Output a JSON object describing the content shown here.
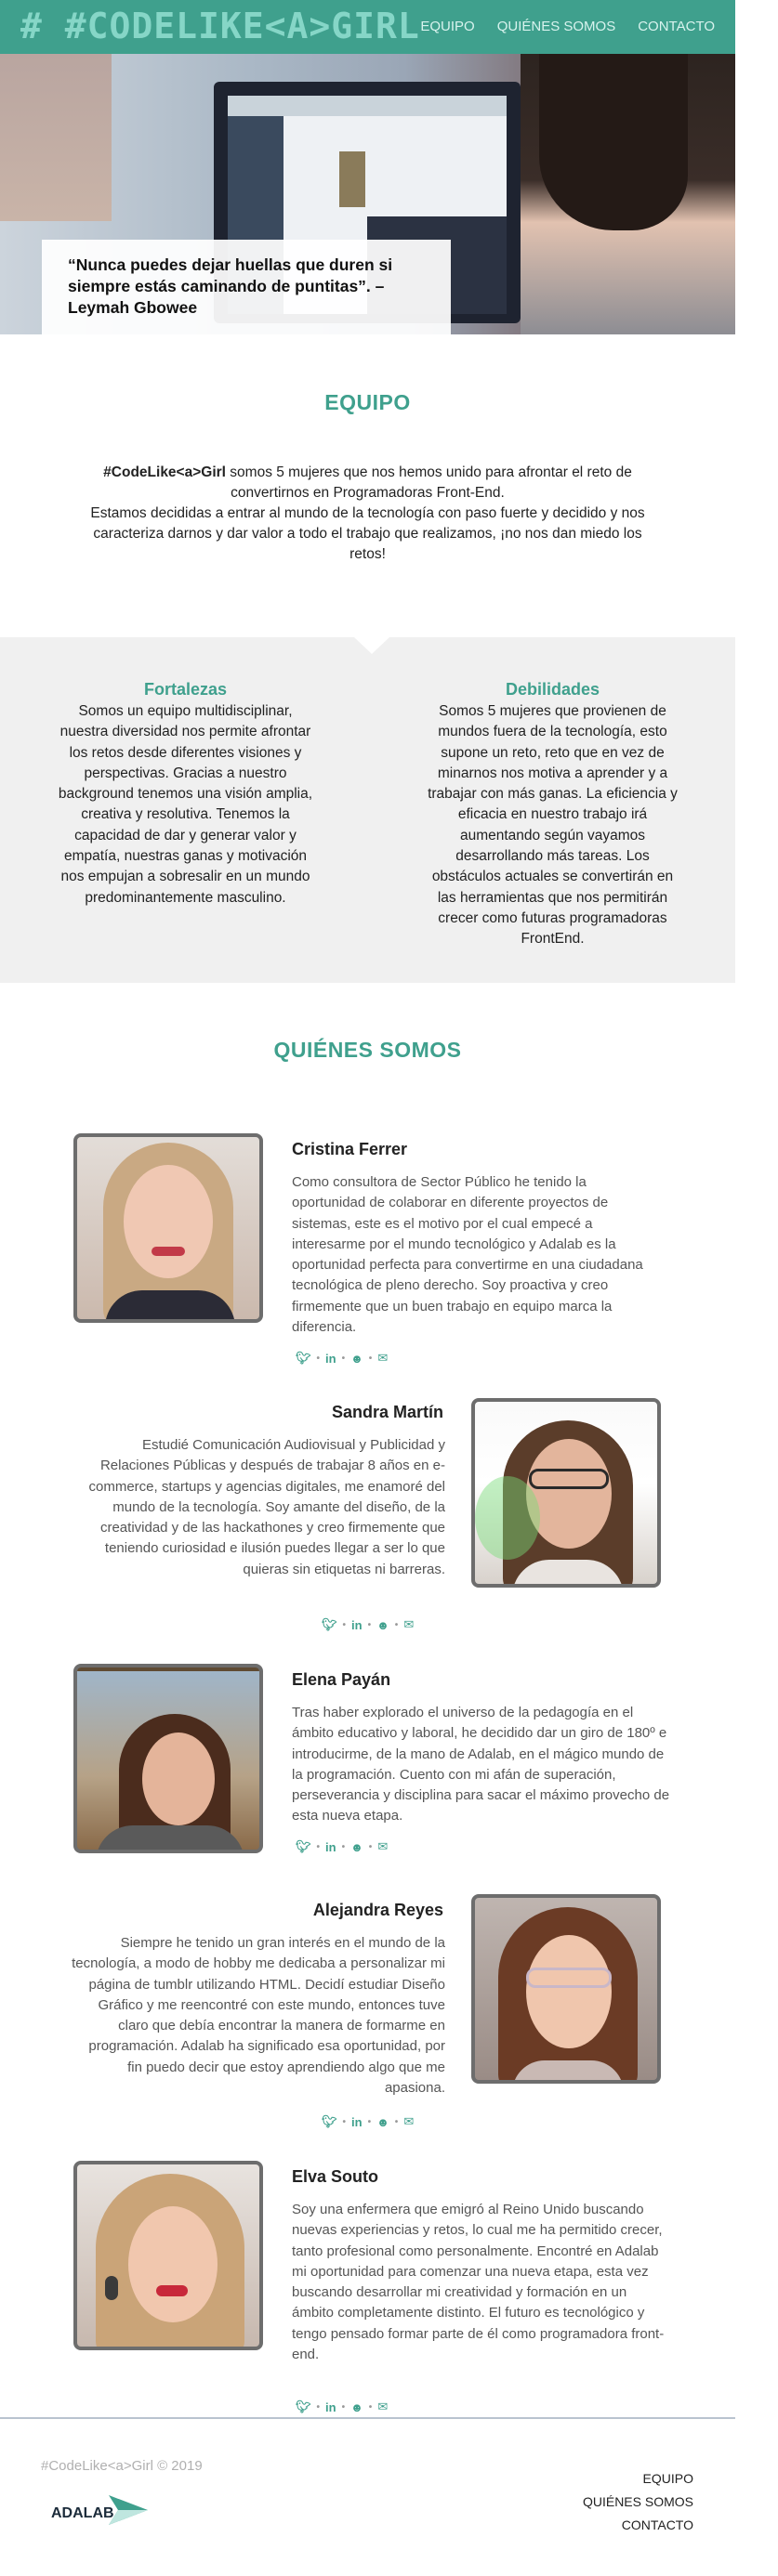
{
  "header": {
    "logo": "# #CODELIKE<A>GIRL",
    "nav": [
      "EQUIPO",
      "QUIÉNES SOMOS",
      "CONTACTO"
    ],
    "color": "#3fa08d"
  },
  "hero": {
    "quote": "“Nunca puedes dejar huellas que duren si siempre estás caminando de puntitas”. –",
    "author": "Leymah Gbowee"
  },
  "equipo": {
    "title": "EQUIPO",
    "brand": "#CodeLike<a>Girl",
    "intro_1": " somos 5 mujeres que nos hemos unido para afrontar el reto de convertirnos en Programadoras Front-End.",
    "intro_2": "Estamos decididas a entrar al mundo de la tecnología con paso fuerte y decidido y nos caracteriza darnos y dar valor a todo el trabajo que realizamos, ¡no nos dan miedo los retos!"
  },
  "fortalezas": {
    "title": "Fortalezas",
    "text": "Somos un equipo multidisciplinar, nuestra diversidad nos permite afrontar los retos desde diferentes visiones y perspectivas. Gracias a nuestro background tenemos una visión amplia, creativa y resolutiva. Tenemos la capacidad de dar y generar valor y empatía, nuestras ganas y motivación nos empujan a sobresalir en un mundo predominantemente masculino."
  },
  "debilidades": {
    "title": "Debilidades",
    "text": "Somos 5 mujeres que provienen de mundos fuera de la tecnología, esto supone un reto, reto que en vez de minarnos nos motiva a aprender y a trabajar con más ganas. La eficiencia y eficacia en nuestro trabajo irá aumentando según vayamos desarrollando más tareas. Los obstáculos actuales se convertirán en las herramientas que nos permitirán crecer como futuras programadoras FrontEnd."
  },
  "quienes": {
    "title": "QUIÉNES SOMOS",
    "members": [
      {
        "name": "Cristina Ferrer",
        "bio": "Como consultora de Sector Público he tenido la oportunidad de colaborar en diferente proyectos de sistemas, este es el motivo por el cual empecé a interesarme por el mundo tecnológico y Adalab es la oportunidad perfecta para convertirme en una ciudadana tecnológica de pleno derecho. Soy proactiva y creo firmemente que un buen trabajo en equipo marca la diferencia."
      },
      {
        "name": "Sandra Martín",
        "bio": "Estudié Comunicación Audiovisual y Publicidad y Relaciones Públicas y después de trabajar 8 años en e-commerce, startups y agencias digitales, me enamoré del mundo de la tecnología. Soy amante del diseño, de la creatividad y de las hackathones y creo firmemente que teniendo curiosidad e ilusión puedes llegar a ser lo que quieras sin etiquetas ni barreras."
      },
      {
        "name": "Elena Payán",
        "bio": "Tras haber explorado el universo de la pedagogía en el ámbito educativo y laboral, he decidido dar un giro de 180º e introducirme, de la mano de Adalab, en el mágico mundo de la programación. Cuento con mi afán de superación, perseverancia y disciplina para sacar el máximo provecho de esta nueva etapa."
      },
      {
        "name": "Alejandra Reyes",
        "bio": "Siempre he tenido un gran interés en el mundo de la tecnología, a modo de hobby me dedicaba a personalizar mi página de tumblr utilizando HTML. Decidí estudiar Diseño Gráfico y me reencontré con este mundo, entonces tuve claro que debía encontrar la manera de formarme en programación. Adalab ha significado esa oportunidad, por fin puedo decir que estoy aprendiendo algo que me apasiona."
      },
      {
        "name": "Elva Souto",
        "bio": "Soy una enfermera que emigró al Reino Unido buscando nuevas experiencias y retos, lo cual me ha permitido crecer, tanto profesional como personalmente. Encontré en Adalab mi oportunidad para comenzar una nueva etapa, esta vez buscando desarrollar mi creatividad y formación en un ámbito completamente distinto. El futuro es tecnológico y tengo pensado formar parte de él como programadora front-end."
      }
    ],
    "social_icons": [
      "twitter-icon",
      "linkedin-icon",
      "github-icon",
      "email-icon"
    ]
  },
  "footer": {
    "copyright": "#CodeLike<a>Girl © 2019",
    "brand": "ADALAB",
    "nav": [
      "EQUIPO",
      "QUIÉNES SOMOS",
      "CONTACTO"
    ]
  }
}
